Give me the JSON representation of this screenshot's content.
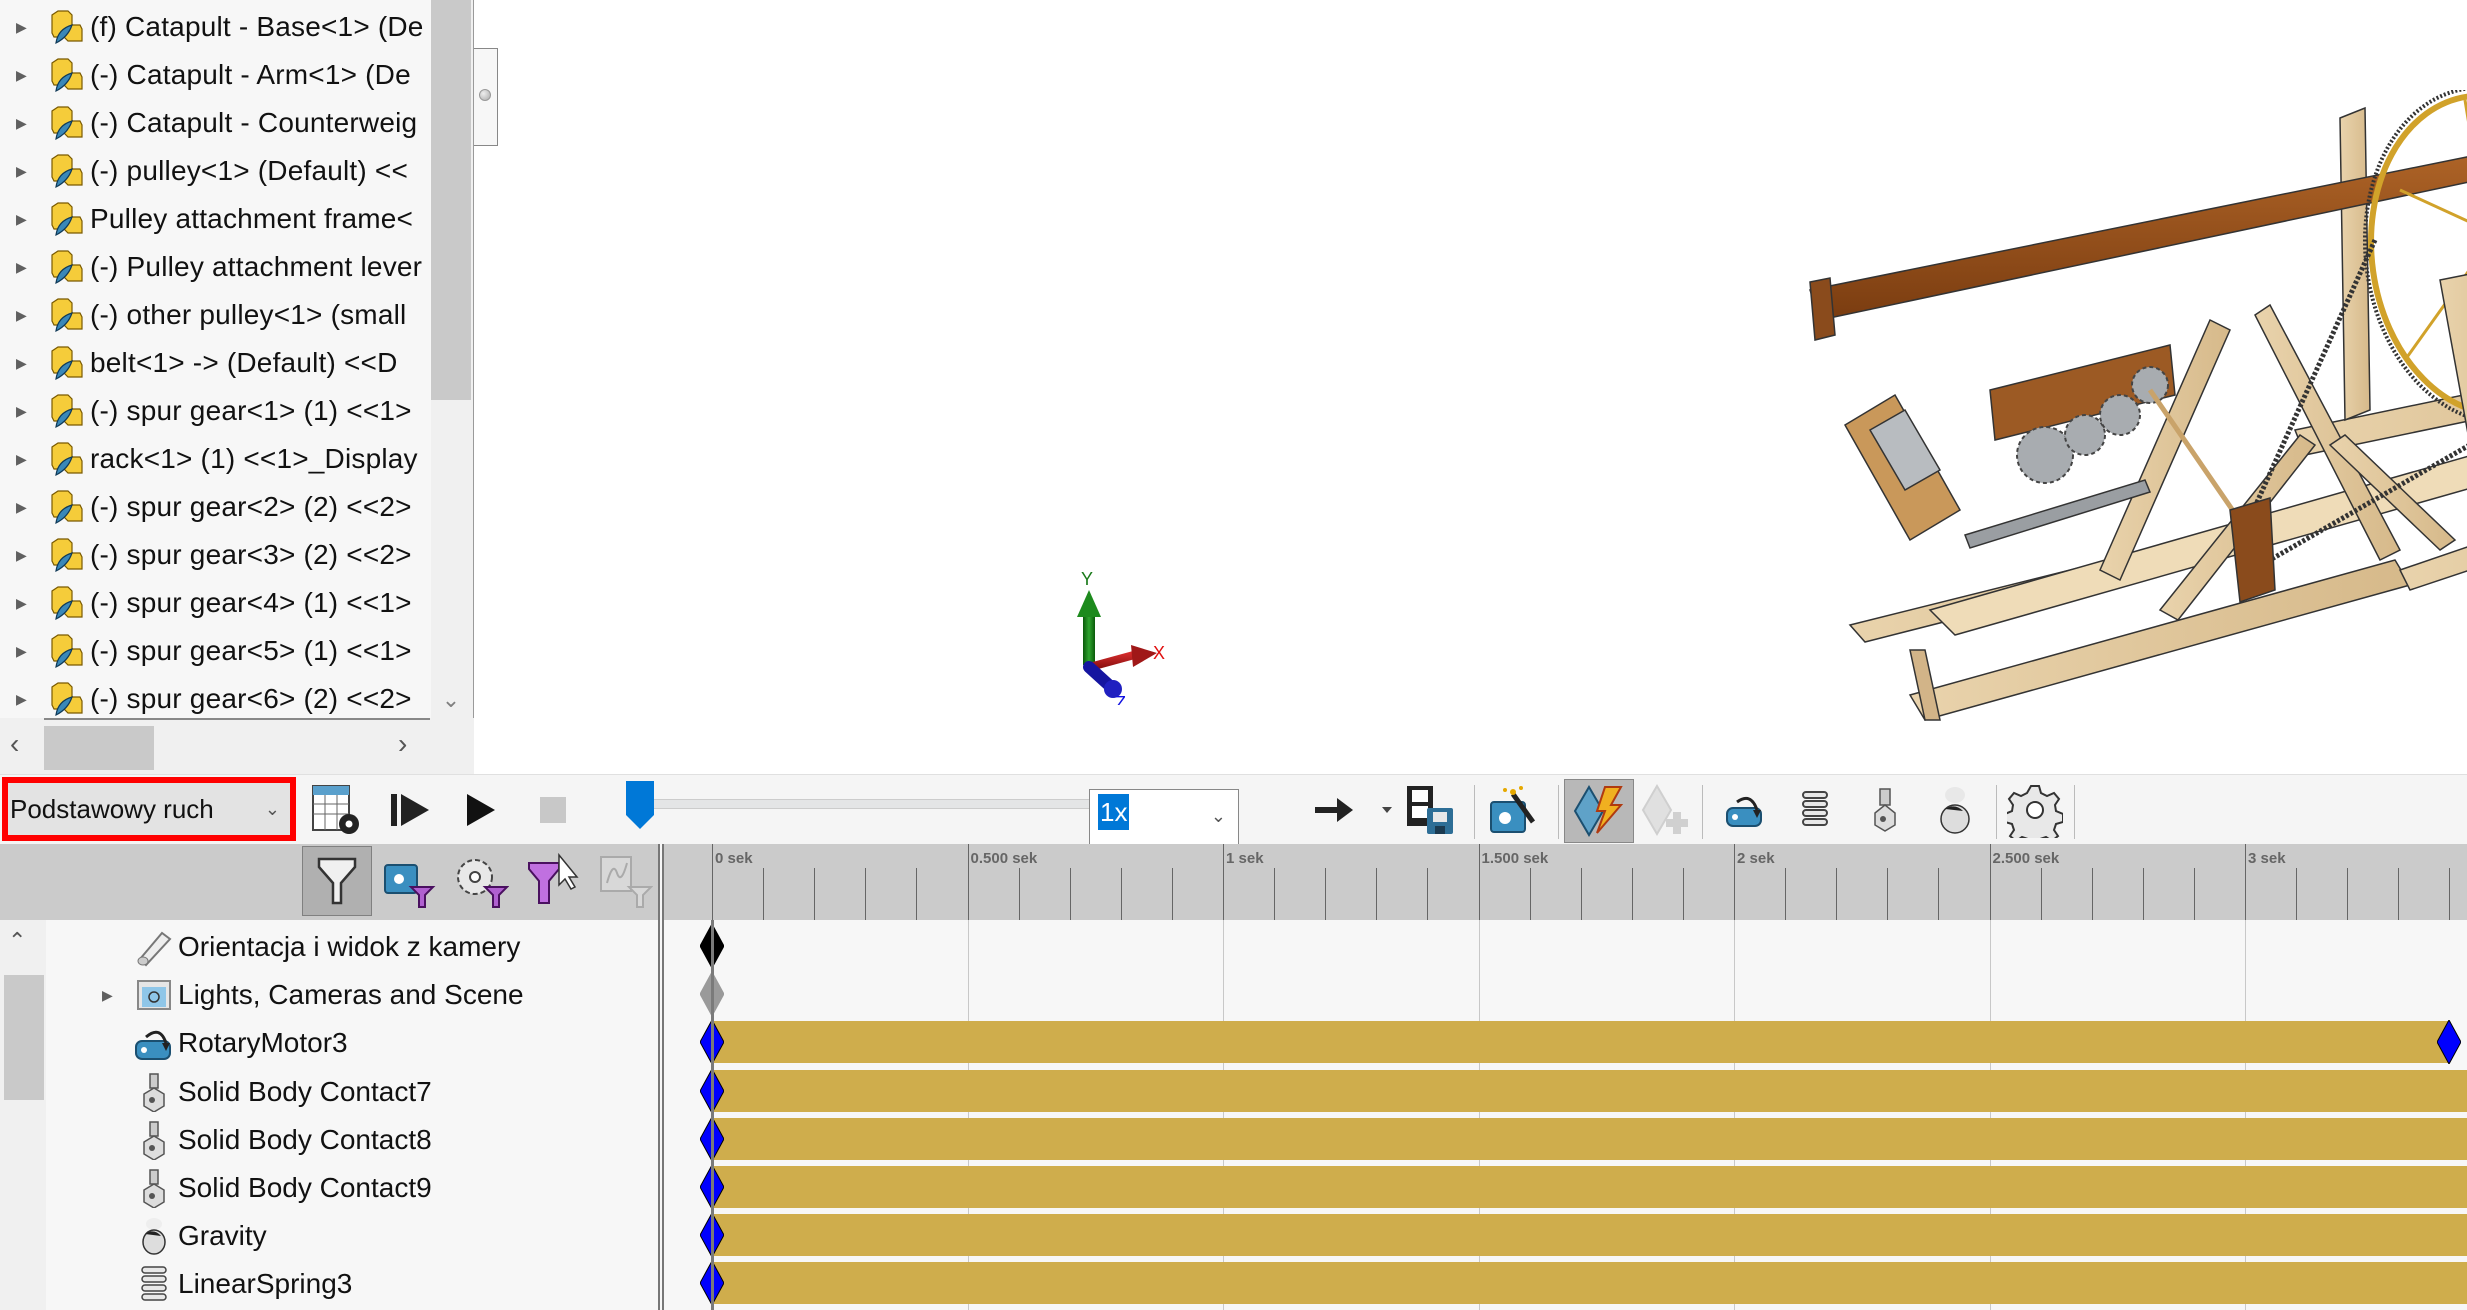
{
  "feature_tree": {
    "items": [
      {
        "label": "(f) Catapult - Base<1> (De",
        "icon": "assembly-component-icon"
      },
      {
        "label": "(-) Catapult - Arm<1> (De",
        "icon": "assembly-component-icon"
      },
      {
        "label": "(-) Catapult - Counterweig",
        "icon": "assembly-component-icon"
      },
      {
        "label": "(-) pulley<1> (Default) <<",
        "icon": "assembly-component-icon"
      },
      {
        "label": "Pulley attachment frame<",
        "icon": "assembly-component-icon"
      },
      {
        "label": "(-) Pulley attachment lever",
        "icon": "assembly-component-icon"
      },
      {
        "label": "(-) other pulley<1> (small",
        "icon": "assembly-component-icon"
      },
      {
        "label": "belt<1> -> (Default) <<D",
        "icon": "assembly-component-icon"
      },
      {
        "label": "(-) spur gear<1> (1) <<1>",
        "icon": "assembly-component-icon"
      },
      {
        "label": "rack<1> (1) <<1>_Display",
        "icon": "assembly-component-icon"
      },
      {
        "label": "(-) spur gear<2> (2) <<2>",
        "icon": "assembly-component-icon"
      },
      {
        "label": "(-) spur gear<3> (2) <<2>",
        "icon": "assembly-component-icon"
      },
      {
        "label": "(-) spur gear<4> (1) <<1>",
        "icon": "assembly-component-icon"
      },
      {
        "label": "(-) spur gear<5> (1) <<1>",
        "icon": "assembly-component-icon"
      },
      {
        "label": "(-) spur gear<6> (2) <<2>",
        "icon": "assembly-component-icon"
      }
    ]
  },
  "triad": {
    "x": "X",
    "y": "Y",
    "z": "Z"
  },
  "toolbar": {
    "study_type": "Podstawowy ruch",
    "speed": "1x",
    "buttons": [
      {
        "name": "calculate-button",
        "icon": "table-gear-icon"
      },
      {
        "name": "play-from-start-button",
        "icon": "play-from-start-icon"
      },
      {
        "name": "play-button",
        "icon": "play-icon"
      },
      {
        "name": "stop-button",
        "icon": "stop-icon"
      },
      {
        "name": "playback-mode-button",
        "icon": "arrow-right-icon"
      },
      {
        "name": "save-animation-button",
        "icon": "film-save-icon"
      },
      {
        "name": "animation-wizard-button",
        "icon": "camera-wand-icon"
      },
      {
        "name": "autokey-button",
        "icon": "autokey-lightning-icon"
      },
      {
        "name": "add-key-button",
        "icon": "add-key-icon"
      },
      {
        "name": "motor-button",
        "icon": "motor-icon"
      },
      {
        "name": "spring-button",
        "icon": "spring-icon"
      },
      {
        "name": "contact-button",
        "icon": "contact-icon"
      },
      {
        "name": "gravity-button",
        "icon": "gravity-icon"
      },
      {
        "name": "study-properties-button",
        "icon": "gear-icon"
      }
    ],
    "time_slider_fraction": 0.0
  },
  "filters": [
    {
      "name": "filter-animated-button",
      "icon": "funnel-icon"
    },
    {
      "name": "filter-driving-button",
      "icon": "camera-funnel-icon"
    },
    {
      "name": "filter-selected-button",
      "icon": "gear-funnel-icon"
    },
    {
      "name": "filter-results-button",
      "icon": "funnel-cursor-icon"
    },
    {
      "name": "filter-results-graph-button",
      "icon": "graph-funnel-icon"
    }
  ],
  "timeline": {
    "unit": "sek",
    "ticks": [
      {
        "t": 0,
        "label": "0 sek"
      },
      {
        "t": 0.5,
        "label": "0.500 sek"
      },
      {
        "t": 1,
        "label": "1 sek"
      },
      {
        "t": 1.5,
        "label": "1.500 sek"
      },
      {
        "t": 2,
        "label": "2 sek"
      },
      {
        "t": 2.5,
        "label": "2.500 sek"
      },
      {
        "t": 3,
        "label": "3 sek"
      }
    ],
    "minor_step": 0.1,
    "visible_range": [
      -0.1,
      3.43
    ],
    "playhead_time": 0,
    "rows": [
      {
        "label": "Orientacja i widok z kamery",
        "icon": "camera-view-icon",
        "expandable": false,
        "key_color": "#000000",
        "keys": [
          0
        ],
        "bar": null
      },
      {
        "label": "Lights, Cameras and Scene",
        "icon": "lights-cameras-scene-icon",
        "expandable": true,
        "key_color": "#9a9a9a",
        "keys": [
          0
        ],
        "bar": null
      },
      {
        "label": "RotaryMotor3",
        "icon": "rotary-motor-icon",
        "expandable": false,
        "key_color": "#0000ff",
        "keys": [
          0,
          3.4
        ],
        "bar": [
          0,
          3.4
        ]
      },
      {
        "label": "Solid Body Contact7",
        "icon": "contact-icon",
        "expandable": false,
        "key_color": "#0000ff",
        "keys": [
          0
        ],
        "bar": [
          0,
          3.5
        ]
      },
      {
        "label": "Solid Body Contact8",
        "icon": "contact-icon",
        "expandable": false,
        "key_color": "#0000ff",
        "keys": [
          0
        ],
        "bar": [
          0,
          3.5
        ]
      },
      {
        "label": "Solid Body Contact9",
        "icon": "contact-icon",
        "expandable": false,
        "key_color": "#0000ff",
        "keys": [
          0
        ],
        "bar": [
          0,
          3.5
        ]
      },
      {
        "label": "Gravity",
        "icon": "gravity-icon",
        "expandable": false,
        "key_color": "#0000ff",
        "keys": [
          0
        ],
        "bar": [
          0,
          3.5
        ]
      },
      {
        "label": "LinearSpring3",
        "icon": "linear-spring-icon",
        "expandable": false,
        "key_color": "#0000ff",
        "keys": [
          0
        ],
        "bar": [
          0,
          3.5
        ]
      }
    ],
    "bar_color": "#cfad4c"
  },
  "colors": {
    "highlight_border": "#ff0000",
    "slider_thumb": "#0078d7",
    "selection": "#0078d7"
  }
}
